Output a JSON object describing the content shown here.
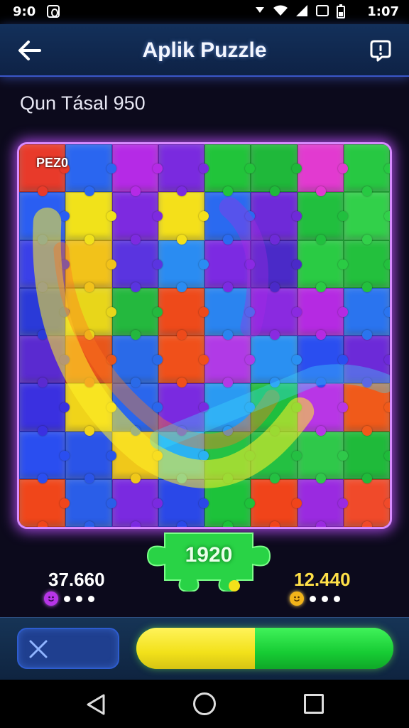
{
  "status_bar": {
    "time_left": "9:0",
    "time_right": "1:07",
    "icons": [
      "download-arrow-icon",
      "wifi-icon",
      "signal-icon",
      "nfc-icon",
      "battery-icon"
    ]
  },
  "header": {
    "title": "Aplik Puzzle",
    "back_icon": "arrow-left-icon",
    "report_icon": "alert-bubble-icon"
  },
  "subtitle": "Qun Tásal 950",
  "board": {
    "label": "PEZ0",
    "rows": 8,
    "cols": 8,
    "piece_colors": [
      [
        "#e83a2a",
        "#2a66f0",
        "#b52ae6",
        "#7a2adf",
        "#21c43a",
        "#1fb83a",
        "#e23ad0",
        "#27c842"
      ],
      [
        "#2a5ef2",
        "#f1e21a",
        "#7d2ae0",
        "#f4e01a",
        "#2a6af0",
        "#6e2ad8",
        "#21bf3e",
        "#32d04a"
      ],
      [
        "#3a40e8",
        "#f2c21a",
        "#5a34e0",
        "#2a8cf2",
        "#7c2ae2",
        "#4a2ac8",
        "#2acb44",
        "#23c03d"
      ],
      [
        "#2a3ad8",
        "#e8d61a",
        "#24b83e",
        "#ee4a1a",
        "#2a84f0",
        "#8a2ae0",
        "#b52ae2",
        "#2a74ef"
      ],
      [
        "#5a2ad0",
        "#e8561a",
        "#2a6ae8",
        "#f0501a",
        "#b13ae6",
        "#2a90f2",
        "#2a4ef0",
        "#6c2ad8"
      ],
      [
        "#3a30e0",
        "#f0d41a",
        "#2a66ec",
        "#7a2ae0",
        "#2a9af2",
        "#1fbe3e",
        "#b836e6",
        "#f05a1a"
      ],
      [
        "#2a4ef0",
        "#2a54e8",
        "#f0c81a",
        "#2ab2f2",
        "#24c244",
        "#24c042",
        "#2fc84a",
        "#1fba3a"
      ],
      [
        "#f0461a",
        "#2a5ee8",
        "#7a2ae0",
        "#2a48e8",
        "#1dc23a",
        "#f0441a",
        "#9a2ae0",
        "#f04a2a"
      ]
    ]
  },
  "center_piece": {
    "value": "1920",
    "color": "#29d346"
  },
  "scores": {
    "left": "37.660",
    "right": "12.440",
    "left_avatar_icon": "purple-face-icon",
    "right_avatar_icon": "yellow-smiley-icon"
  },
  "bottom_bar": {
    "close_icon": "close-x-icon",
    "progress": 0.46,
    "progress_fill_color": "#f2e11a",
    "progress_rest_color": "#17cc34"
  },
  "nav": {
    "back_icon": "triangle-back-icon",
    "home_icon": "circle-home-icon",
    "recent_icon": "square-recent-icon"
  }
}
